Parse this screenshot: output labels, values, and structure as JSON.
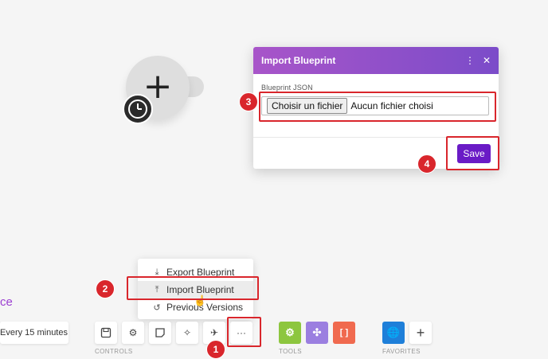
{
  "modal": {
    "title": "Import Blueprint",
    "field_label": "Blueprint JSON",
    "file_button": "Choisir un fichier",
    "file_status": "Aucun fichier choisi",
    "save_label": "Save"
  },
  "menu": {
    "items": [
      {
        "label": "Export Blueprint",
        "icon": "download-icon"
      },
      {
        "label": "Import Blueprint",
        "icon": "upload-icon"
      },
      {
        "label": "Previous Versions",
        "icon": "history-icon"
      }
    ]
  },
  "partial_title": "ce",
  "schedule_text": "Every 15 minutes.",
  "toolbar": {
    "controls_label": "CONTROLS",
    "tools_label": "TOOLS",
    "favorites_label": "FAVORITES",
    "more_label": "···",
    "add_label": "+"
  },
  "annotations": [
    "1",
    "2",
    "3",
    "4"
  ],
  "colors": {
    "accent": "#6a1bc6",
    "header_gradient_start": "#a855c9",
    "header_gradient_end": "#7b4cc9",
    "annotation_red": "#d9262c",
    "tool_green": "#8dc63f",
    "tool_purple": "#9b7fe0",
    "tool_orange": "#f06a4f",
    "favorite_blue": "#1e7fd9"
  }
}
